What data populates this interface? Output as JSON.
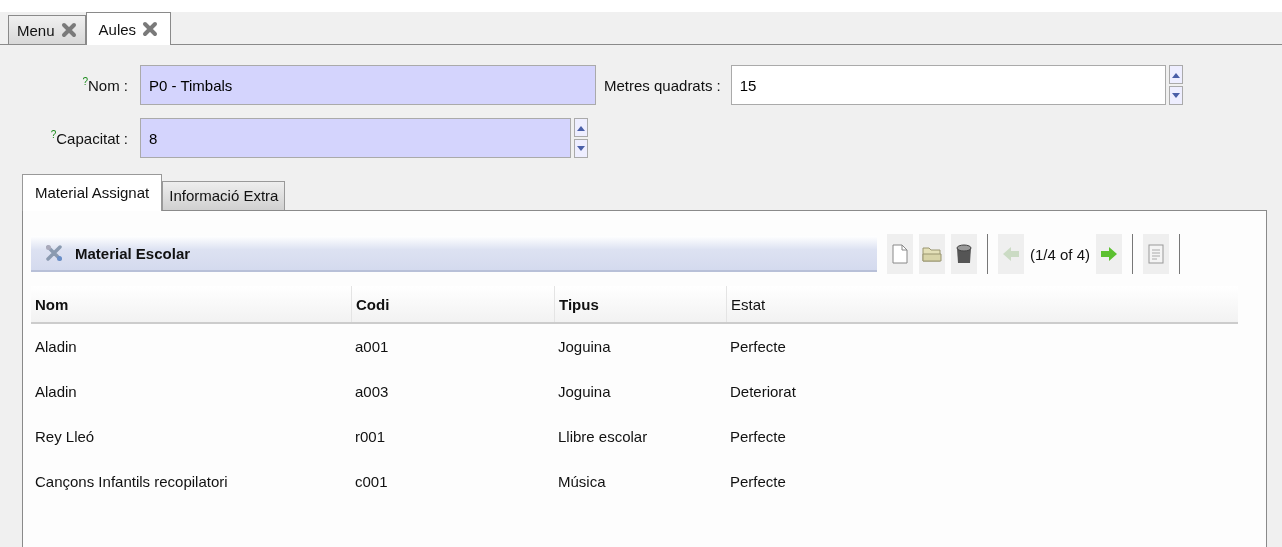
{
  "tabs": [
    {
      "label": "Menu",
      "selected": false
    },
    {
      "label": "Aules",
      "selected": true
    }
  ],
  "form_rows": [
    [
      {
        "label": "$^{?}$Nom :",
        "value": "P0 - Timbals",
        "required": true,
        "kind": "text"
      },
      {
        "label": "Metres quadrats :",
        "value": "15",
        "required": false,
        "kind": "spinner"
      }
    ],
    [
      {
        "label": "$^{?}$Capacitat :",
        "value": "8",
        "required": true,
        "kind": "spinner"
      }
    ]
  ],
  "inner_tabs": [
    {
      "label": "Material Assignat",
      "selected": true
    },
    {
      "label": "Informació Extra",
      "selected": false
    }
  ],
  "panel": {
    "title": "Material Escolar",
    "toolbar": [
      {
        "kind": "new",
        "disabled": false
      },
      {
        "kind": "open",
        "disabled": false
      },
      {
        "kind": "delete",
        "disabled": false
      },
      {
        "kind": "separator"
      },
      {
        "kind": "prev",
        "disabled": true
      },
      {
        "kind": "label",
        "text": "(1/4 of 4)"
      },
      {
        "kind": "next",
        "disabled": false
      },
      {
        "kind": "separator"
      },
      {
        "kind": "report",
        "disabled": false
      },
      {
        "kind": "separator"
      }
    ],
    "columns": [
      {
        "label": "Nom",
        "bold": true
      },
      {
        "label": "Codi",
        "bold": true
      },
      {
        "label": "Tipus",
        "bold": true
      },
      {
        "label": "Estat",
        "bold": false
      }
    ],
    "rows": [
      [
        "Aladin",
        "a001",
        "Joguina",
        "Perfecte"
      ],
      [
        "Aladin",
        "a003",
        "Joguina",
        "Deteriorat"
      ],
      [
        "Rey Lleó",
        "r001",
        "Llibre escolar",
        "Perfecte"
      ],
      [
        "Cançons Infantils recopilatori",
        "c001",
        "Música",
        "Perfecte"
      ]
    ]
  }
}
